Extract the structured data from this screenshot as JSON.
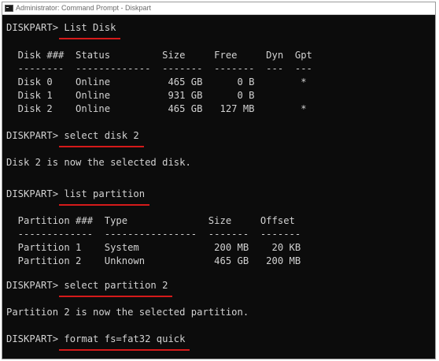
{
  "window": {
    "title": "Administrator: Command Prompt - Diskpart"
  },
  "console": {
    "prompt": "DISKPART> ",
    "commands": [
      "List Disk",
      "select disk 2",
      "list partition",
      "select partition 2",
      "format fs=fat32 quick"
    ],
    "disk_table": {
      "header": "  Disk ###  Status         Size     Free     Dyn  Gpt",
      "separator": "  --------  -------------  -------  -------  ---  ---",
      "rows": [
        "  Disk 0    Online          465 GB      0 B        *",
        "  Disk 1    Online          931 GB      0 B",
        "  Disk 2    Online          465 GB   127 MB        *"
      ]
    },
    "disk_selected_msg": "Disk 2 is now the selected disk.",
    "partition_table": {
      "header": "  Partition ###  Type              Size     Offset",
      "separator": "  -------------  ----------------  -------  -------",
      "rows": [
        "  Partition 1    System             200 MB    20 KB",
        "  Partition 2    Unknown            465 GB   200 MB"
      ]
    },
    "partition_selected_msg": "Partition 2 is now the selected partition."
  },
  "colors": {
    "console_bg": "#0c0c0c",
    "console_text": "#d2d2d2",
    "annotation_underline": "#d51a1a"
  }
}
